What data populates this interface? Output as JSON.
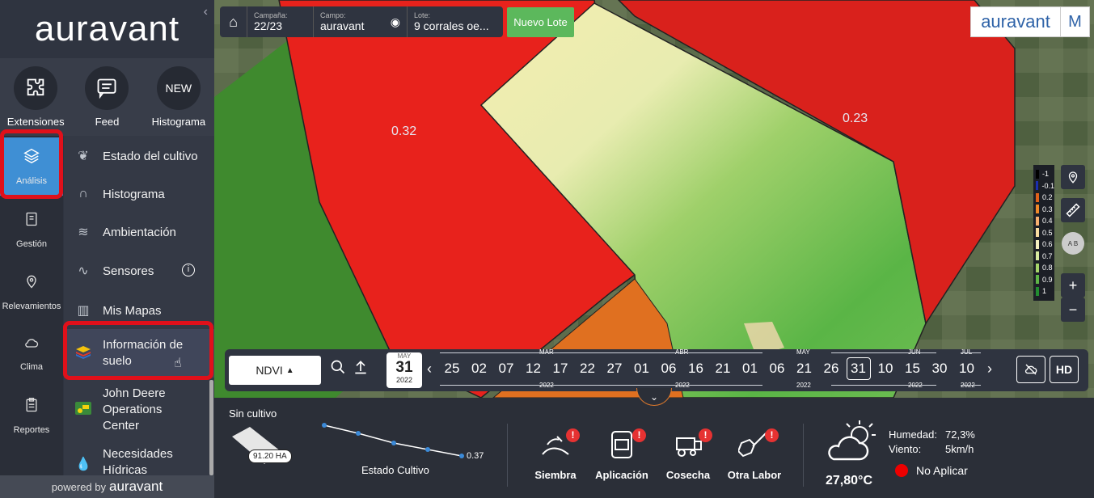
{
  "brand": {
    "logo_text": "auravant",
    "powered_by": "powered by",
    "powered_brand": "auravant",
    "badge_letter": "M"
  },
  "top_icons": [
    {
      "label": "Extensiones",
      "icon": "puzzle-icon"
    },
    {
      "label": "Feed",
      "icon": "chat-icon"
    },
    {
      "label": "Histograma",
      "icon": "new-badge",
      "badge": "NEW"
    }
  ],
  "left_nav": [
    {
      "label": "Análisis",
      "icon": "layers-icon",
      "active": true
    },
    {
      "label": "Gestión",
      "icon": "notebook-icon"
    },
    {
      "label": "Relevamientos",
      "icon": "pin-icon"
    },
    {
      "label": "Clima",
      "icon": "cloud-icon"
    },
    {
      "label": "Reportes",
      "icon": "clipboard-icon"
    }
  ],
  "submenu": [
    {
      "label": "Estado del cultivo",
      "icon": "plant-icon"
    },
    {
      "label": "Histograma",
      "icon": "curve-icon"
    },
    {
      "label": "Ambientación",
      "icon": "layers-icon"
    },
    {
      "label": "Sensores",
      "icon": "pulse-icon",
      "info": "i"
    },
    {
      "label": "Mis Mapas",
      "icon": "map-icon"
    },
    {
      "label": "Información de suelo",
      "icon": "soil-icon",
      "selected": true
    },
    {
      "label": "John Deere Operations Center",
      "icon": "tractor-icon"
    },
    {
      "label": "Necesidades Hídricas",
      "icon": "drop-icon"
    }
  ],
  "topbar": {
    "campaign_label": "Campaña:",
    "campaign": "22/23",
    "field_label": "Campo:",
    "field": "auravant",
    "lot_label": "Lote:",
    "lot": "9 corrales oe...",
    "new_lot": "Nuevo Lote"
  },
  "map": {
    "values": [
      "0.32",
      "0.23"
    ]
  },
  "legend": [
    {
      "v": "-1",
      "c": "#000000"
    },
    {
      "v": "-0.1",
      "c": "#1a2fb0"
    },
    {
      "v": "0.2",
      "c": "#e0621a"
    },
    {
      "v": "0.3",
      "c": "#f08a2a"
    },
    {
      "v": "0.4",
      "c": "#f7b070"
    },
    {
      "v": "0.5",
      "c": "#f8dca0"
    },
    {
      "v": "0.6",
      "c": "#f4f0c0"
    },
    {
      "v": "0.7",
      "c": "#d8eaa0"
    },
    {
      "v": "0.8",
      "c": "#a6d46a"
    },
    {
      "v": "0.9",
      "c": "#5fb547"
    },
    {
      "v": "1",
      "c": "#228c30"
    }
  ],
  "map_controls": {
    "ab": "A B",
    "zoom_in": "+",
    "zoom_out": "−"
  },
  "timeline": {
    "index": "NDVI",
    "selected_date": {
      "month": "MAY",
      "day": "31",
      "year": "2022"
    },
    "days": [
      "25",
      "02",
      "07",
      "12",
      "17",
      "22",
      "27",
      "01",
      "06",
      "16",
      "21",
      "01",
      "06",
      "21",
      "26",
      "31",
      "10",
      "15",
      "30",
      "10"
    ],
    "months": [
      "MAR",
      "ABR",
      "MAY",
      "JUN",
      "JUL"
    ],
    "year": "2022",
    "hd": "HD"
  },
  "bottom": {
    "crop_status": "Sin cultivo",
    "area": "91.20 HA",
    "chart_label": "Estado Cultivo",
    "chart_value": "0.37",
    "actions": [
      "Siembra",
      "Aplicación",
      "Cosecha",
      "Otra Labor"
    ],
    "temperature": "27,80°C",
    "humidity_label": "Humedad:",
    "humidity": "72,3%",
    "wind_label": "Viento:",
    "wind": "5km/h",
    "spray_status": "No Aplicar"
  }
}
